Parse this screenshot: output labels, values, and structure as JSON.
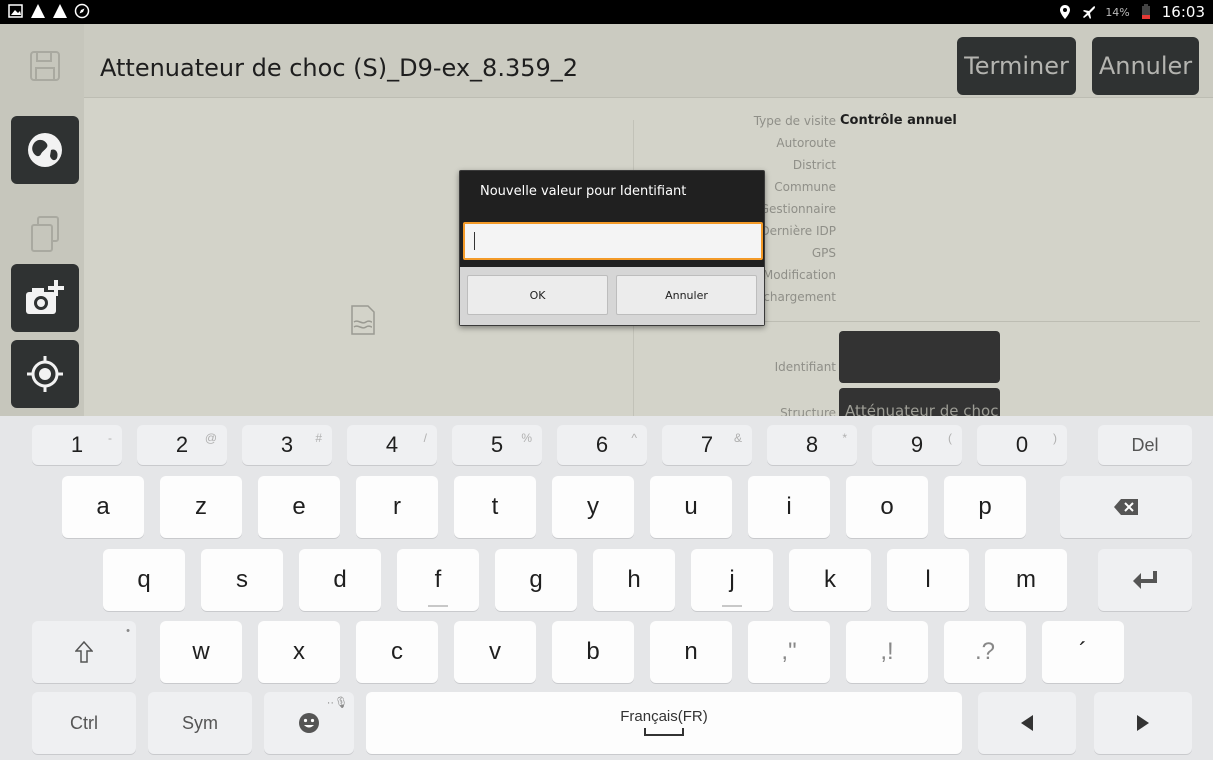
{
  "status_bar": {
    "battery": "14%",
    "time": "16:03"
  },
  "app": {
    "title": "Attenuateur de choc (S)_D9-ex_8.359_2",
    "finish_label": "Terminer",
    "cancel_label": "Annuler",
    "fields": [
      {
        "label": "Type de visite",
        "value": "Contrôle annuel"
      },
      {
        "label": "Autoroute",
        "value": ""
      },
      {
        "label": "District",
        "value": ""
      },
      {
        "label": "Commune",
        "value": ""
      },
      {
        "label": "Gestionnaire",
        "value": ""
      },
      {
        "label": "Dernière IDP",
        "value": ""
      },
      {
        "label": "GPS",
        "value": ""
      },
      {
        "label": "Modification",
        "value": ""
      },
      {
        "label": "Dernier téléchargement",
        "value": ""
      }
    ],
    "identifiant_label": "Identifiant",
    "identifiant_value": "",
    "structure_label": "Structure",
    "structure_value": "Atténuateur de choc"
  },
  "dialog": {
    "title": "Nouvelle valeur pour Identifiant",
    "input_value": "",
    "ok_label": "OK",
    "cancel_label": "Annuler"
  },
  "keyboard": {
    "number_row": [
      {
        "main": "1",
        "alt": "-"
      },
      {
        "main": "2",
        "alt": "@"
      },
      {
        "main": "3",
        "alt": "#"
      },
      {
        "main": "4",
        "alt": "/"
      },
      {
        "main": "5",
        "alt": "%"
      },
      {
        "main": "6",
        "alt": "^"
      },
      {
        "main": "7",
        "alt": "&"
      },
      {
        "main": "8",
        "alt": "*"
      },
      {
        "main": "9",
        "alt": "("
      },
      {
        "main": "0",
        "alt": ")"
      }
    ],
    "del_label": "Del",
    "row1": [
      "a",
      "z",
      "e",
      "r",
      "t",
      "y",
      "u",
      "i",
      "o",
      "p"
    ],
    "row2": [
      "q",
      "s",
      "d",
      "f",
      "g",
      "h",
      "j",
      "k",
      "l",
      "m"
    ],
    "row3": [
      "w",
      "x",
      "c",
      "v",
      "b",
      "n"
    ],
    "punct": [
      ",\"",
      ",!",
      ".?",
      "´"
    ],
    "ctrl_label": "Ctrl",
    "sym_label": "Sym",
    "space_label": "Français(FR)"
  }
}
